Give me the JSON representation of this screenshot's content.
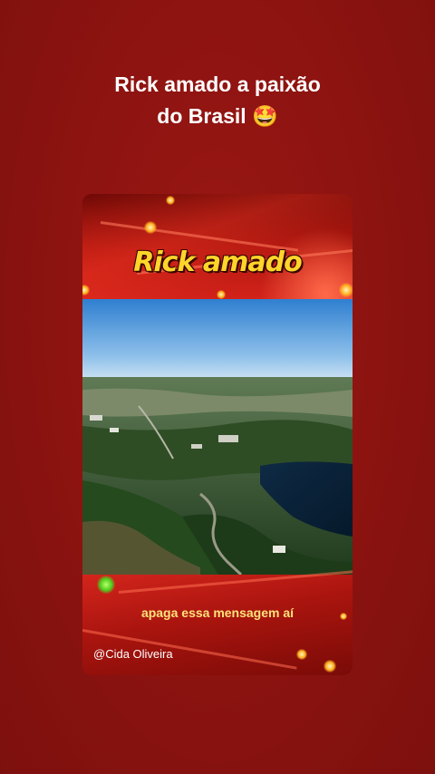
{
  "post": {
    "headline_line1": "Rick amado a paixão",
    "headline_line2": "do Brasil 🤩"
  },
  "video": {
    "title_overlay": "Rick amado",
    "caption": "apaga essa mensagem aí",
    "credit": "@Cida Oliveira",
    "frame_colors": {
      "background": "#8e1411",
      "frame_red": "#c11d14",
      "title_yellow": "#ffd52a",
      "caption_yellow": "#ffe27a"
    }
  }
}
